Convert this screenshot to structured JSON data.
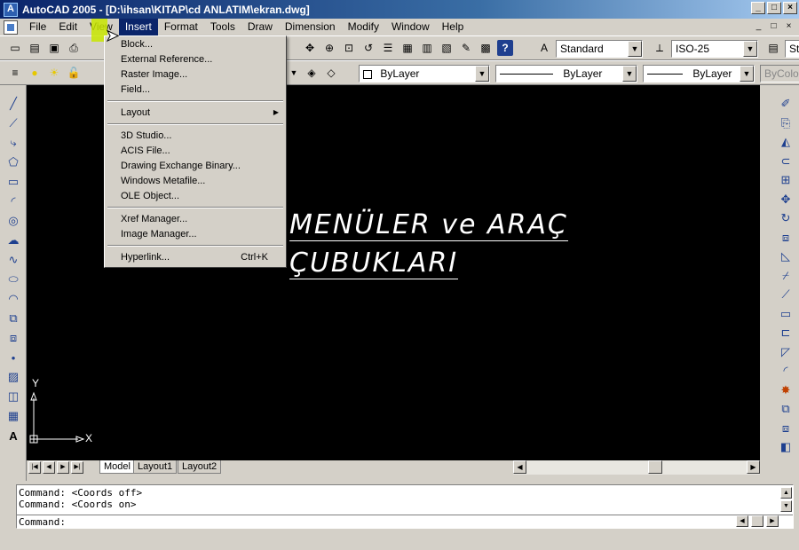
{
  "window": {
    "title": "AutoCAD 2005 - [D:\\ihsan\\KITAP\\cd ANLATIM\\ekran.dwg]"
  },
  "menubar": {
    "items": [
      "File",
      "Edit",
      "View",
      "Insert",
      "Format",
      "Tools",
      "Draw",
      "Dimension",
      "Modify",
      "Window",
      "Help"
    ]
  },
  "toolbar": {
    "text_style": "Standard",
    "dim_style": "ISO-25",
    "table_style": "St",
    "layer_color": "ByLayer",
    "linetype": "ByLayer",
    "lineweight": "ByLayer",
    "plotstyle": "ByColor"
  },
  "insert_menu": {
    "items": [
      {
        "label": "Block..."
      },
      {
        "label": "External Reference..."
      },
      {
        "label": "Raster Image..."
      },
      {
        "label": "Field..."
      },
      {
        "label": "Layout"
      },
      {
        "label": "3D Studio..."
      },
      {
        "label": "ACIS File..."
      },
      {
        "label": "Drawing Exchange Binary..."
      },
      {
        "label": "Windows Metafile..."
      },
      {
        "label": "OLE Object..."
      },
      {
        "label": "Xref Manager..."
      },
      {
        "label": "Image Manager..."
      },
      {
        "label": "Hyperlink...",
        "shortcut": "Ctrl+K"
      }
    ]
  },
  "drawing": {
    "line1": "MENÜLER ve ARAÇ",
    "line2": "ÇUBUKLARI",
    "ucs_x": "X",
    "ucs_y": "Y"
  },
  "layout_tabs": [
    "Model",
    "Layout1",
    "Layout2"
  ],
  "command": {
    "history": [
      "Command:  <Coords off>",
      "Command:  <Coords on>"
    ],
    "prompt": "Command:"
  }
}
